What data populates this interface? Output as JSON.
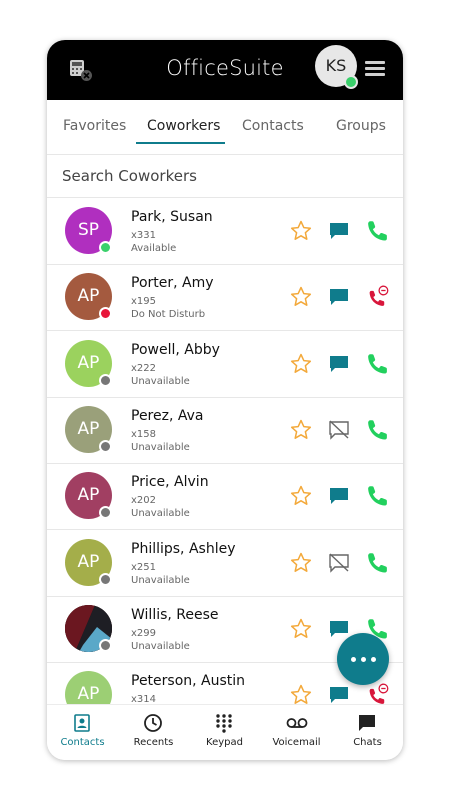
{
  "app": {
    "title": "OfficeSuite",
    "user_initials": "KS"
  },
  "tabs": [
    {
      "label": "Favorites"
    },
    {
      "label": "Coworkers",
      "active": true
    },
    {
      "label": "Contacts"
    },
    {
      "label": "Groups"
    }
  ],
  "search": {
    "placeholder": "Search Coworkers"
  },
  "coworkers": [
    {
      "initials": "SP",
      "name": "Park, Susan",
      "ext": "x331",
      "status": "Available",
      "avatar_color": "#b02fbf",
      "status_color": "#3ad06b",
      "chat": "enabled",
      "call": "available"
    },
    {
      "initials": "AP",
      "name": "Porter, Amy",
      "ext": "x195",
      "status": "Do Not Disturb",
      "avatar_color": "#a45a3f",
      "status_color": "#e8163b",
      "chat": "enabled",
      "call": "dnd"
    },
    {
      "initials": "AP",
      "name": "Powell, Abby",
      "ext": "x222",
      "status": "Unavailable",
      "avatar_color": "#9bd25e",
      "status_color": "#777777",
      "chat": "enabled",
      "call": "available"
    },
    {
      "initials": "AP",
      "name": "Perez, Ava",
      "ext": "x158",
      "status": "Unavailable",
      "avatar_color": "#9aa07a",
      "status_color": "#777777",
      "chat": "disabled",
      "call": "available"
    },
    {
      "initials": "AP",
      "name": "Price, Alvin",
      "ext": "x202",
      "status": "Unavailable",
      "avatar_color": "#a13f62",
      "status_color": "#777777",
      "chat": "enabled",
      "call": "available"
    },
    {
      "initials": "AP",
      "name": "Phillips, Ashley",
      "ext": "x251",
      "status": "Unavailable",
      "avatar_color": "#a4ae4a",
      "status_color": "#777777",
      "chat": "disabled",
      "call": "available"
    },
    {
      "initials": "",
      "name": "Willis, Reese",
      "ext": "x299",
      "status": "Unavailable",
      "avatar_color": "#3b1a1a",
      "status_color": "#777777",
      "chat": "enabled",
      "call": "available",
      "photo": true
    },
    {
      "initials": "AP",
      "name": "Peterson, Austin",
      "ext": "x314",
      "status": "",
      "avatar_color": "#9ccf74",
      "status_color": "#777777",
      "chat": "enabled",
      "call": "dnd"
    }
  ],
  "bottom_nav": [
    {
      "label": "Contacts",
      "icon": "contacts-icon",
      "active": true
    },
    {
      "label": "Recents",
      "icon": "clock-icon"
    },
    {
      "label": "Keypad",
      "icon": "keypad-icon"
    },
    {
      "label": "Voicemail",
      "icon": "voicemail-icon"
    },
    {
      "label": "Chats",
      "icon": "chat-bubble-icon"
    }
  ],
  "colors": {
    "accent": "#0f7c8c",
    "star": "#f3a93b",
    "call_green": "#22d05e",
    "dnd_red": "#d8163b"
  }
}
